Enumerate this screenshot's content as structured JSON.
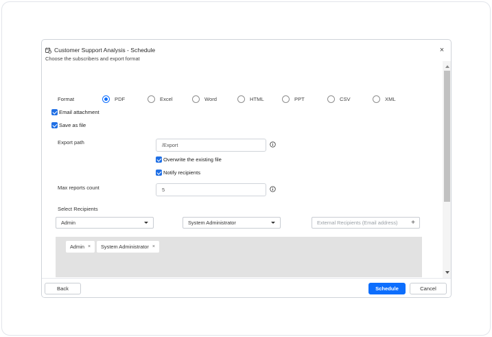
{
  "dialog": {
    "title": "Customer Support Analysis - Schedule",
    "subtitle": "Choose the subscribers and export format",
    "close_symbol": "×",
    "title_icon": "calendar-clock-icon"
  },
  "format": {
    "label": "Format",
    "options": [
      "PDF",
      "Excel",
      "Word",
      "HTML",
      "PPT",
      "CSV",
      "XML"
    ],
    "selected": "PDF"
  },
  "options": {
    "email_attachment": "Email attachment",
    "save_as_file": "Save as file"
  },
  "export": {
    "path_label": "Export path",
    "path_value": "/Export",
    "overwrite_label": "Overwrite the existing file",
    "notify_label": "Notify recipients",
    "max_label": "Max reports count",
    "max_value": "5"
  },
  "recipients": {
    "label": "Select Recipients",
    "group_select": "Admin",
    "user_select": "System Administrator",
    "external_placeholder": "External Recipients (Email address)",
    "add_symbol": "+",
    "chips": [
      "Admin",
      "System Administrator"
    ],
    "chip_remove": "×"
  },
  "footer": {
    "back": "Back",
    "schedule": "Schedule",
    "cancel": "Cancel"
  },
  "colors": {
    "accent": "#0d6efd",
    "checkbox": "#1f6fe5",
    "recipients_bg": "#e2e2e2"
  }
}
